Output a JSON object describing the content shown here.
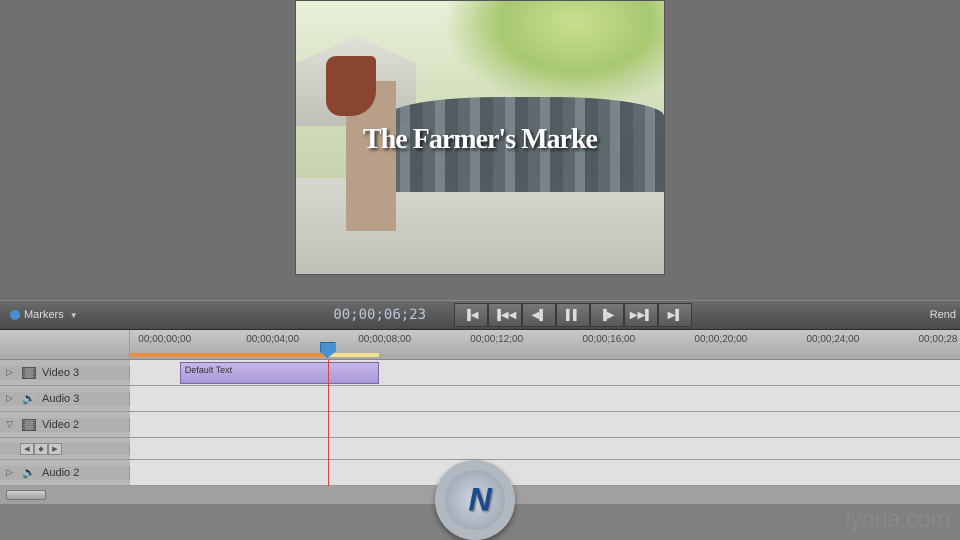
{
  "preview": {
    "title_overlay": "The Farmer's Marke"
  },
  "controls": {
    "markers_label": "Markers",
    "timecode": "00;00;06;23",
    "render_label": "Rend"
  },
  "transport_icons": {
    "first": "▐◀",
    "prev": "▐◀◀",
    "stepback": "◀▌",
    "pause": "▌▌",
    "stepfwd": "▐▶",
    "next": "▶▶▌",
    "last": "▶▌"
  },
  "ruler": {
    "ticks": [
      "00;00;00;00",
      "00;00;04;00",
      "00;00;08;00",
      "00;00;12;00",
      "00;00;16;00",
      "00;00;20;00",
      "00;00;24;00",
      "00;00;28"
    ],
    "playhead_pct": 23.8,
    "orange_end_pct": 23.8,
    "pale_start_pct": 23.8,
    "pale_end_pct": 30
  },
  "tracks": [
    {
      "name": "Video 3",
      "type": "video",
      "expanded": false,
      "clips": [
        {
          "label": "Default Text",
          "start_pct": 6,
          "width_pct": 24
        }
      ]
    },
    {
      "name": "Audio 3",
      "type": "audio",
      "expanded": false,
      "clips": []
    },
    {
      "name": "Video 2",
      "type": "video",
      "expanded": true,
      "clips": []
    },
    {
      "name": "Audio 2",
      "type": "audio",
      "expanded": false,
      "clips": []
    }
  ],
  "watermark": {
    "logo_letter": "N",
    "text": "lynda.com"
  }
}
